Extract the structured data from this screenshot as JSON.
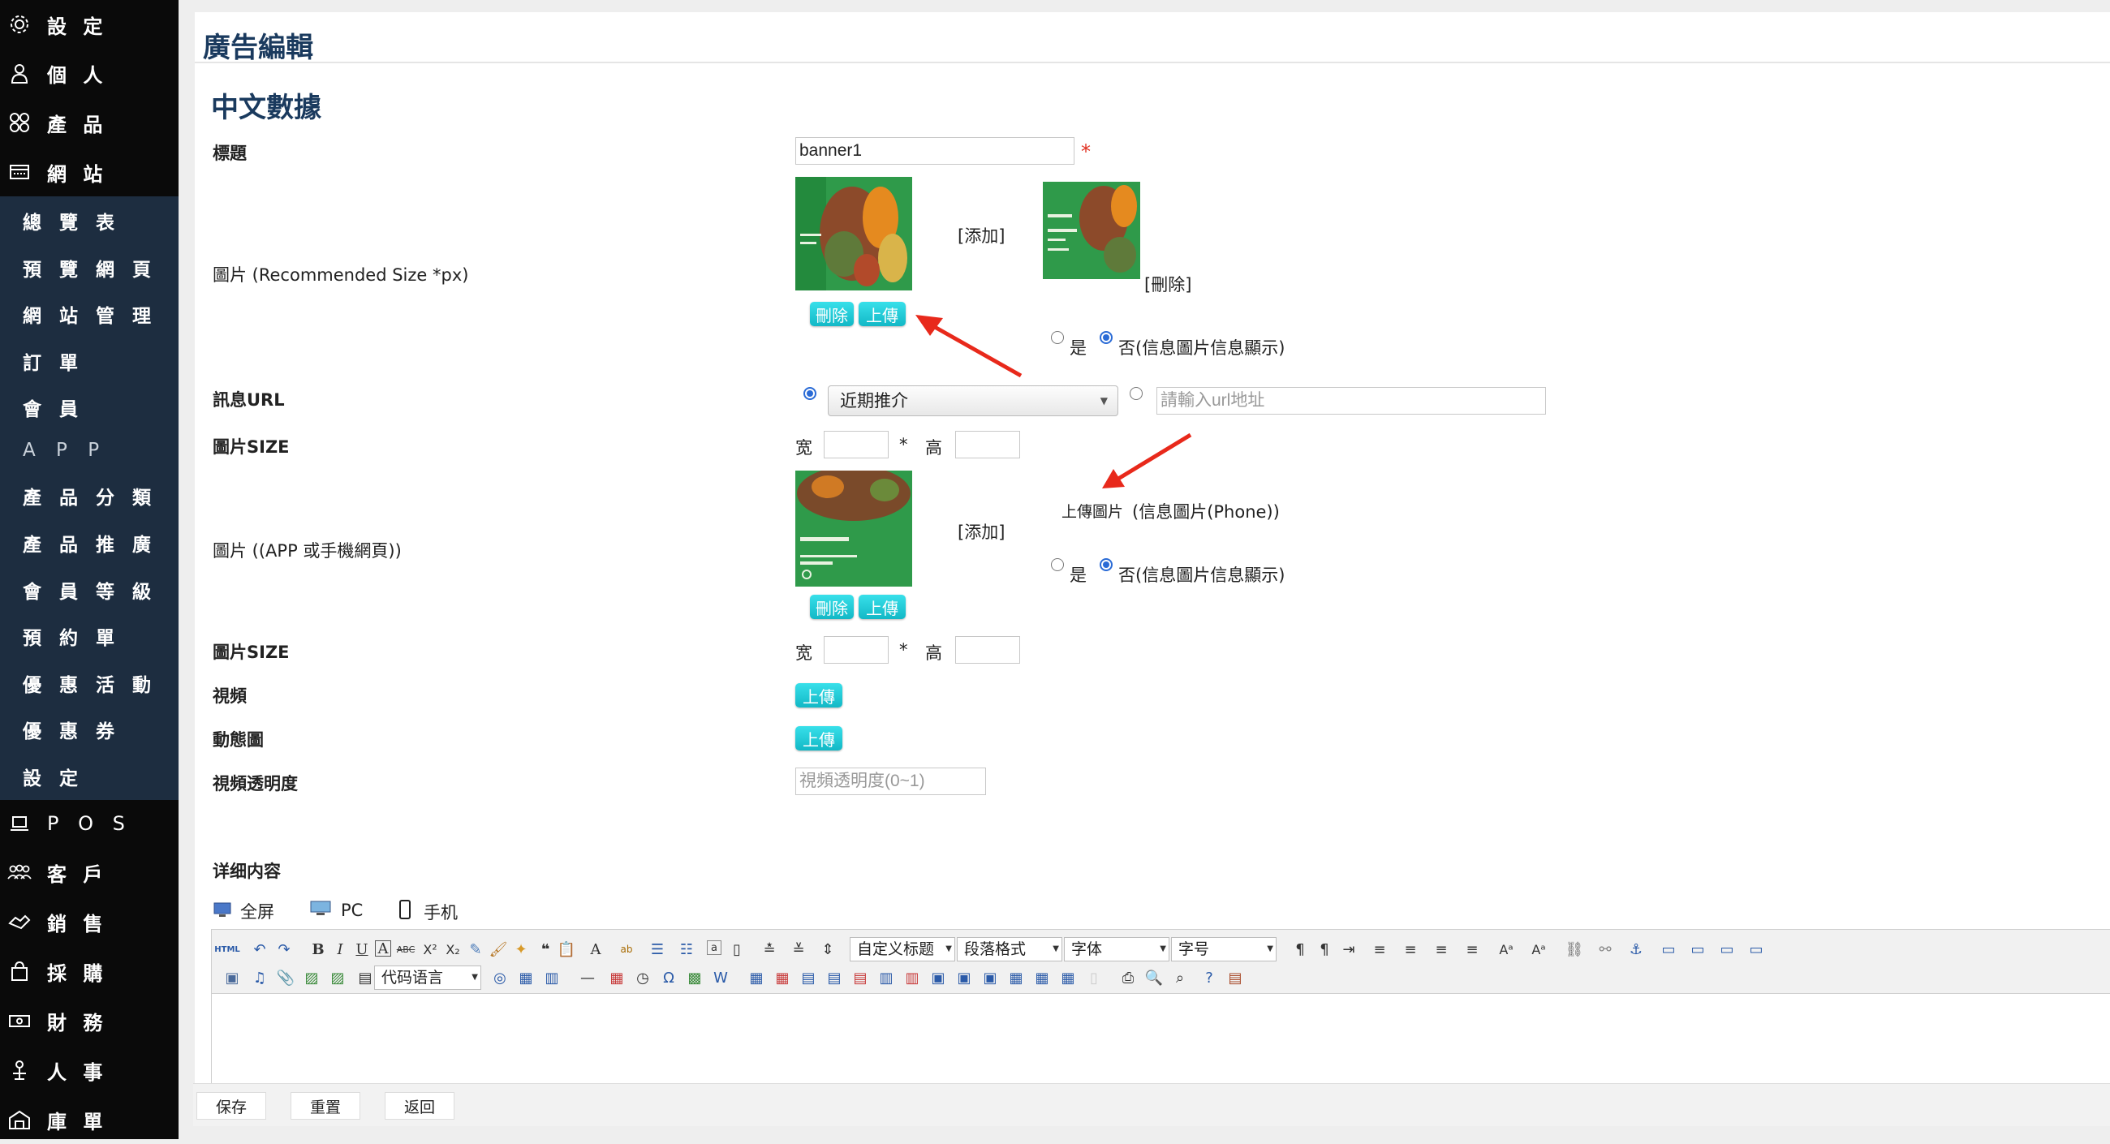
{
  "sidebar": {
    "items": [
      {
        "label": "設 定",
        "icon": "gear-icon"
      },
      {
        "label": "個 人",
        "icon": "user-icon"
      },
      {
        "label": "產 品",
        "icon": "grid-icon"
      },
      {
        "label": "網 站",
        "icon": "browser-icon"
      }
    ],
    "submenu": [
      "總 覽 表",
      "預 覽 網 頁",
      "網 站 管 理",
      "訂 單",
      "會 員",
      "A P P",
      "產 品 分 類",
      "產 品 推 廣",
      "會 員 等 級",
      "預 約 單",
      "優 惠 活 動",
      "優 惠 券",
      "設 定"
    ],
    "bottom_items": [
      {
        "label": "P O S",
        "icon": "laptop-icon"
      },
      {
        "label": "客 戶",
        "icon": "group-icon"
      },
      {
        "label": "銷 售",
        "icon": "handshake-icon"
      },
      {
        "label": "採 購",
        "icon": "bag-icon"
      },
      {
        "label": "財 務",
        "icon": "money-icon"
      },
      {
        "label": "人 事",
        "icon": "person-desk-icon"
      },
      {
        "label": "庫 單",
        "icon": "warehouse-icon"
      }
    ]
  },
  "page": {
    "title": "廣告編輯",
    "section": "中文數據"
  },
  "form": {
    "title_label": "標題",
    "title_value": "banner1",
    "required_mark": "*",
    "image_label": "圖片 (Recommended Size *px)",
    "add_link": "[添加]",
    "delete_link": "[刪除]",
    "delete_btn": "刪除",
    "upload_btn": "上傳",
    "yes": "是",
    "no_info": "否(信息圖片信息顯示)",
    "url_label": "訊息URL",
    "url_select": "近期推介",
    "url_placeholder": "請輸入url地址",
    "size_label": "圖片SIZE",
    "width": "宽",
    "times": "*",
    "height": "高",
    "app_image_label": "圖片 ((APP 或手機網頁))",
    "upload_image_text": "上傳圖片",
    "phone_info": "(信息圖片(Phone))",
    "video_label": "視頻",
    "gif_label": "動態圖",
    "opacity_label": "視頻透明度",
    "opacity_placeholder": "視頻透明度(0~1)",
    "detail_label": "详细内容"
  },
  "editor": {
    "views": [
      {
        "label": "全屏",
        "icon": "monitor-icon"
      },
      {
        "label": "PC",
        "icon": "pc-icon"
      },
      {
        "label": "手机",
        "icon": "phone-icon"
      }
    ],
    "dropdowns": {
      "custom_title": "自定义标题",
      "paragraph": "段落格式",
      "font": "字体",
      "font_size": "字号",
      "code_language": "代码语言"
    }
  },
  "actions": {
    "save": "保存",
    "reset": "重置",
    "back": "返回"
  },
  "colors": {
    "sidebar_bg": "#0a0a0a",
    "submenu_bg": "#1d2d40",
    "title_color": "#1a3a5e",
    "button_cyan": "#12b8c6",
    "annotation_arrow": "#e8291b"
  }
}
